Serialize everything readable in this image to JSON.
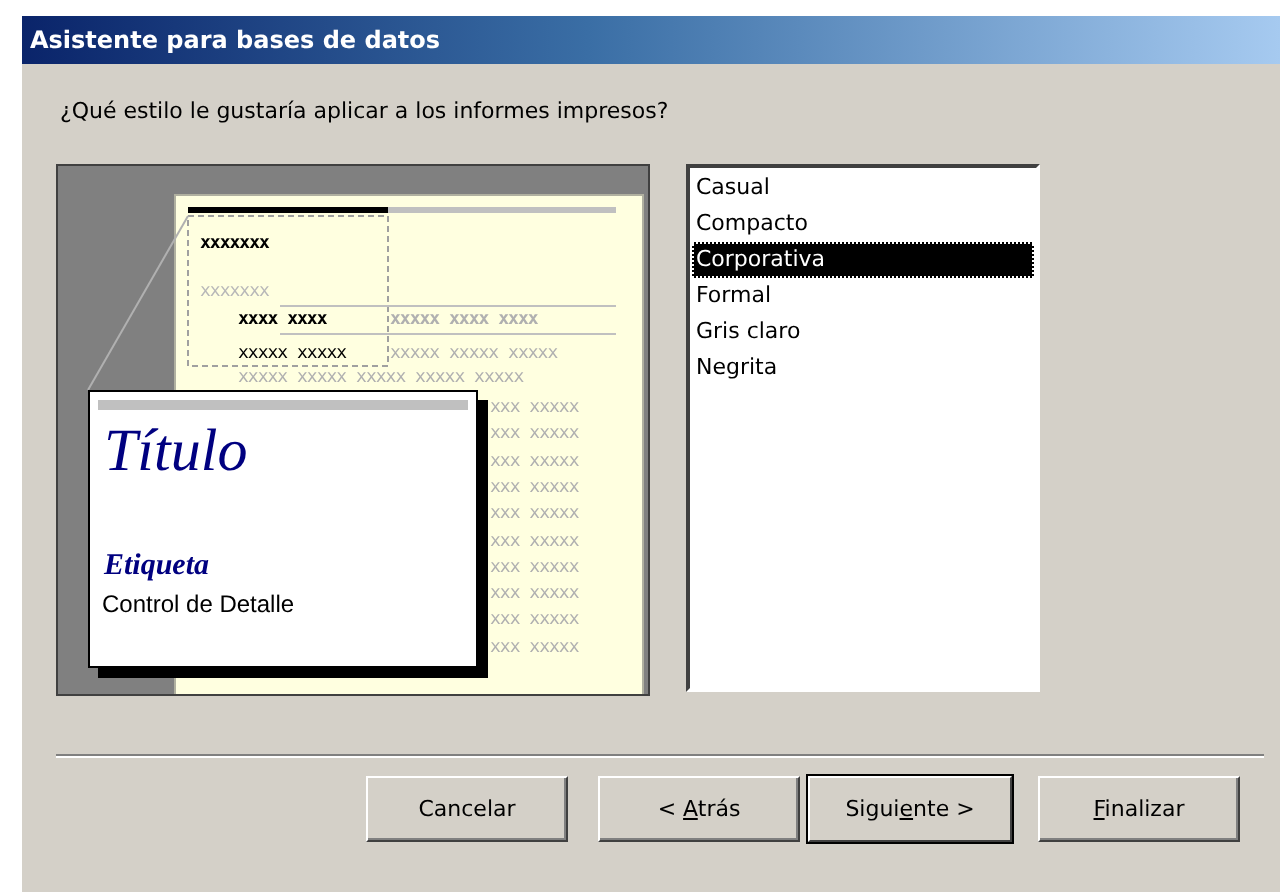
{
  "window": {
    "title": "Asistente para bases de datos"
  },
  "question": "¿Qué estilo le gustaría aplicar a los informes impresos?",
  "preview": {
    "title": "Título",
    "label": "Etiqueta",
    "detail": "Control de Detalle",
    "group_header": "xxxxxxx",
    "group_subheader": "xxxxxxx",
    "header_row": {
      "lead": "xxxx xxxx",
      "rest": "xxxxx xxxx xxxx"
    },
    "first_row": {
      "lead": "xxxxx xxxxx",
      "rest": "xxxxx xxxxx xxxxx"
    },
    "second_row": "xxxxx xxxxx xxxxx xxxxx xxxxx",
    "covered_rows": [
      "xxx xxxxx",
      "xxx xxxxx",
      "xxx xxxxx",
      "xxx xxxxx",
      "xxx xxxxx",
      "xxx xxxxx",
      "xxx xxxxx",
      "xxx xxxxx",
      "xxx xxxxx",
      "xxx xxxxx"
    ]
  },
  "styles": [
    {
      "label": "Casual",
      "selected": false
    },
    {
      "label": "Compacto",
      "selected": false
    },
    {
      "label": "Corporativa",
      "selected": true
    },
    {
      "label": "Formal",
      "selected": false
    },
    {
      "label": "Gris claro",
      "selected": false
    },
    {
      "label": "Negrita",
      "selected": false
    }
  ],
  "buttons": [
    {
      "before": "Cancelar",
      "default": false
    },
    {
      "before": "< ",
      "key": "A",
      "after": "trás",
      "default": false
    },
    {
      "before": "Sigui",
      "key": "e",
      "after": "nte >",
      "default": true
    },
    {
      "key": "F",
      "after": "inalizar",
      "default": false
    }
  ]
}
